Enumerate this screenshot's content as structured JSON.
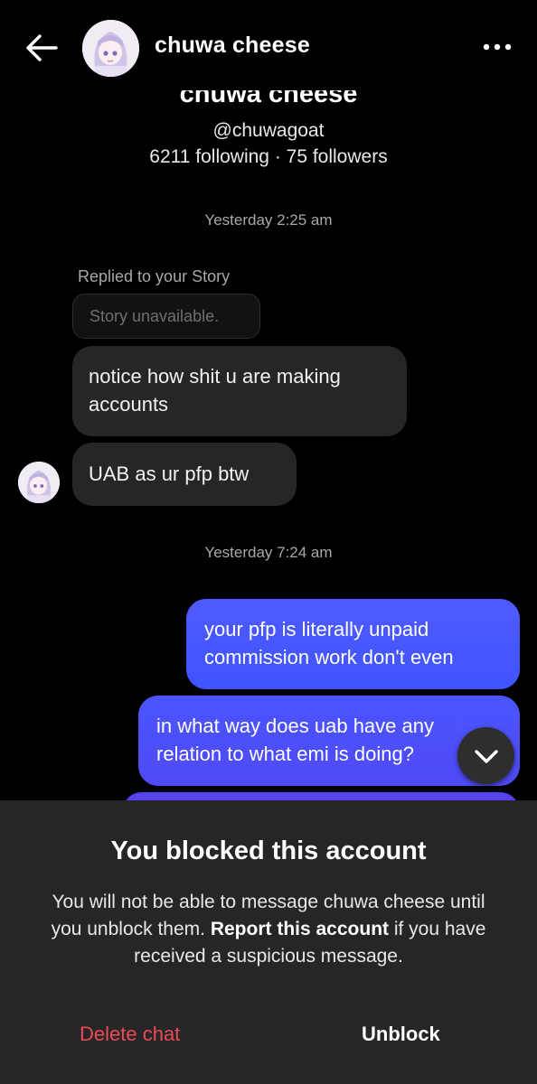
{
  "header": {
    "name": "chuwa cheese",
    "back_icon": "arrow-left-icon",
    "more_icon": "more-horizontal-icon"
  },
  "profile": {
    "name": "chuwa cheese",
    "handle": "@chuwagoat",
    "stats": "6211 following · 75 followers"
  },
  "thread": {
    "timestamp_1": "Yesterday 2:25 am",
    "replied_label": "Replied to your Story",
    "story_unavailable": "Story unavailable.",
    "incoming": [
      "notice how shit u are making accounts",
      "UAB as ur pfp btw"
    ],
    "timestamp_2": "Yesterday 7:24 am",
    "outgoing": [
      "your pfp is literally unpaid commission work don't even",
      "in what way does uab have any relation to what emi is doing?"
    ]
  },
  "scroll_icon": "chevron-down-icon",
  "blocked_sheet": {
    "title": "You blocked this account",
    "body_before": "You will not be able to message chuwa cheese until you unblock them. ",
    "body_bold": "Report this account",
    "body_after": " if you have received a suspicious message.",
    "delete_label": "Delete chat",
    "unblock_label": "Unblock"
  },
  "colors": {
    "background": "#000000",
    "incoming_bubble": "#262626",
    "outgoing_bubble": "#4f5bff",
    "sheet": "#262626",
    "delete": "#ed4956"
  }
}
